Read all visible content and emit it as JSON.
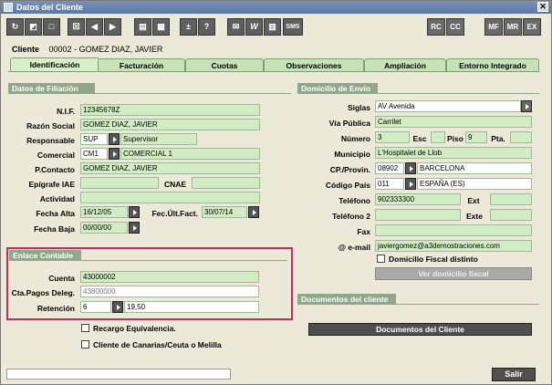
{
  "window": {
    "title": "Datos del Cliente",
    "close": "✕"
  },
  "toolbar": {
    "left_icons": [
      "refresh-icon",
      "edit-icon",
      "new-icon",
      "delete-icon",
      "prev-icon",
      "next-icon",
      "print-icon",
      "list-icon",
      "plusminus-icon",
      "help-icon",
      "email-icon",
      "word-icon",
      "calculator-icon"
    ],
    "plus_minus": "±",
    "question": "?",
    "word": "W",
    "sms": "SMS",
    "rc": "RC",
    "cc": "CC",
    "mf": "MF",
    "mr": "MR",
    "ex": "EX"
  },
  "client": {
    "label": "Cliente",
    "code": "00002",
    "name": "- GOMEZ DIAZ, JAVIER"
  },
  "tabs": [
    "Identificación",
    "Facturación",
    "Cuotas",
    "Observaciones",
    "Ampliación",
    "Entorno Integrado"
  ],
  "filiacion": {
    "title": "Datos de Filiación",
    "nif_label": "N.I.F.",
    "nif": "12345678Z",
    "razon_label": "Razón Social",
    "razon": "GOMEZ DIAZ, JAVIER",
    "resp_label": "Responsable",
    "resp_code": "SUP",
    "resp_name": "Supervisor",
    "comercial_label": "Comercial",
    "comercial_code": "CM1",
    "comercial_name": "COMERCIAL 1",
    "contacto_label": "P.Contacto",
    "contacto": "GOMEZ DIAZ, JAVIER",
    "epigrafe_label": "Epígrafe IAE",
    "cnae_label": "CNAE",
    "actividad_label": "Actividad",
    "fecha_alta_label": "Fecha Alta",
    "fecha_alta": "16/12/05",
    "fec_ult_label": "Fec.Últ.Fact.",
    "fec_ult": "30/07/14",
    "fecha_baja_label": "Fecha Baja",
    "fecha_baja": "00/00/00"
  },
  "contable": {
    "title": "Enlace Contable",
    "cuenta_label": "Cuenta",
    "cuenta": "43000002",
    "ctapagos_label": "Cta.Pagos Deleg.",
    "ctapagos": "43800000",
    "retencion_label": "Retención",
    "retencion_code": "6",
    "retencion_value": "19,50"
  },
  "checks": {
    "recargo": "Recargo Equivalencia.",
    "canarias": "Cliente de Canarias/Ceuta o Melilla"
  },
  "envio": {
    "title": "Domicilio de Envío",
    "siglas_label": "Siglas",
    "siglas": "AV Avenida",
    "via_label": "Vía Pública",
    "via": "Carrilet",
    "numero_label": "Número",
    "numero": "3",
    "esc_label": "Esc",
    "piso_label": "Piso",
    "piso": "9",
    "pta_label": "Pta.",
    "municipio_label": "Municipio",
    "municipio": "L'Hospitalet de Llob",
    "cp_label": "CP./Provin.",
    "cp": "08902",
    "provincia": "BARCELONA",
    "pais_label": "Código País",
    "pais_code": "011",
    "pais_name": "ESPAÑA (ES)",
    "telefono_label": "Teléfono",
    "telefono": "902333300",
    "ext_label": "Ext",
    "telefono2_label": "Teléfono 2",
    "exte_label": "Exte",
    "fax_label": "Fax",
    "email_label": "@ e-mail",
    "email": "javiergomez@a3demostraciones.com",
    "fiscal_check": "Domicilio Fiscal distinto",
    "fiscal_btn": "Ver domicilio fiscal"
  },
  "documentos": {
    "title": "Documentos del cliente",
    "button": "Documentos del Cliente"
  },
  "footer": {
    "exit": "Salir"
  }
}
